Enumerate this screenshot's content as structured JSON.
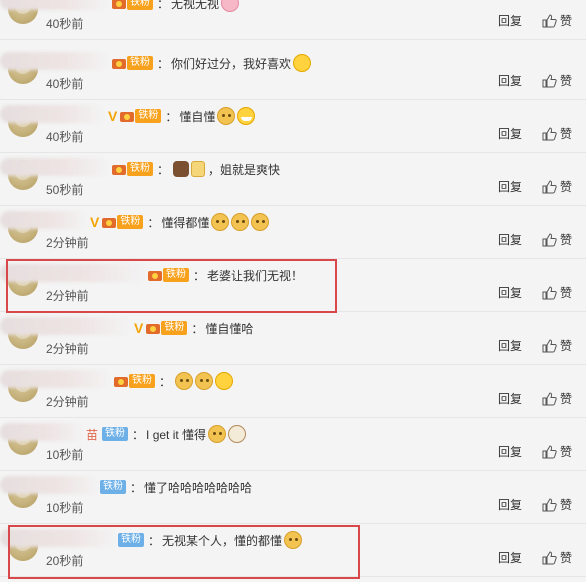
{
  "actions": {
    "reply_label": "回复",
    "like_label": "赞"
  },
  "comments": [
    {
      "time": "40秒前",
      "badge": "铁粉",
      "text": "无视无视",
      "emoji": [
        "pig-emoji"
      ]
    },
    {
      "time": "40秒前",
      "badge": "铁粉",
      "text": "你们好过分，我好喜欢",
      "emoji": [
        "smile-emoji"
      ]
    },
    {
      "time": "40秒前",
      "badge": "铁粉",
      "text": "懂自懂",
      "emoji": [
        "doge-emoji",
        "laugh-emoji"
      ]
    },
    {
      "time": "50秒前",
      "badge": "铁粉",
      "text": "",
      "tail": "，姐就是爽快",
      "emoji": [
        "cat-emoji",
        "beer-emoji"
      ]
    },
    {
      "time": "2分钟前",
      "badge": "铁粉",
      "text": "懂得都懂",
      "emoji": [
        "doge-emoji",
        "doge-emoji",
        "doge-emoji"
      ]
    },
    {
      "time": "2分钟前",
      "badge": "铁粉",
      "text": "老婆让我们无视！",
      "emoji": []
    },
    {
      "time": "2分钟前",
      "badge": "铁粉",
      "text": "懂自懂哈",
      "emoji": []
    },
    {
      "time": "2分钟前",
      "badge": "铁粉",
      "text": "",
      "emoji": [
        "doge-emoji",
        "doge-emoji",
        "shock-emoji"
      ]
    },
    {
      "time": "10秒前",
      "badge": "铁粉",
      "name_fragment": "苗",
      "text": "I get it 懂得",
      "emoji": [
        "doge-emoji",
        "panda-emoji"
      ]
    },
    {
      "time": "10秒前",
      "badge": "铁粉",
      "text": "懂了哈哈哈哈哈哈哈",
      "emoji": []
    },
    {
      "time": "20秒前",
      "badge": "铁粉",
      "text": "无视某个人，懂的都懂",
      "emoji": [
        "doge-emoji"
      ]
    }
  ],
  "colors": {
    "highlight": "#d8474a",
    "badge_orange": "#f7a11c",
    "badge_blue": "#6db0e8",
    "vip": "#f3a405"
  }
}
